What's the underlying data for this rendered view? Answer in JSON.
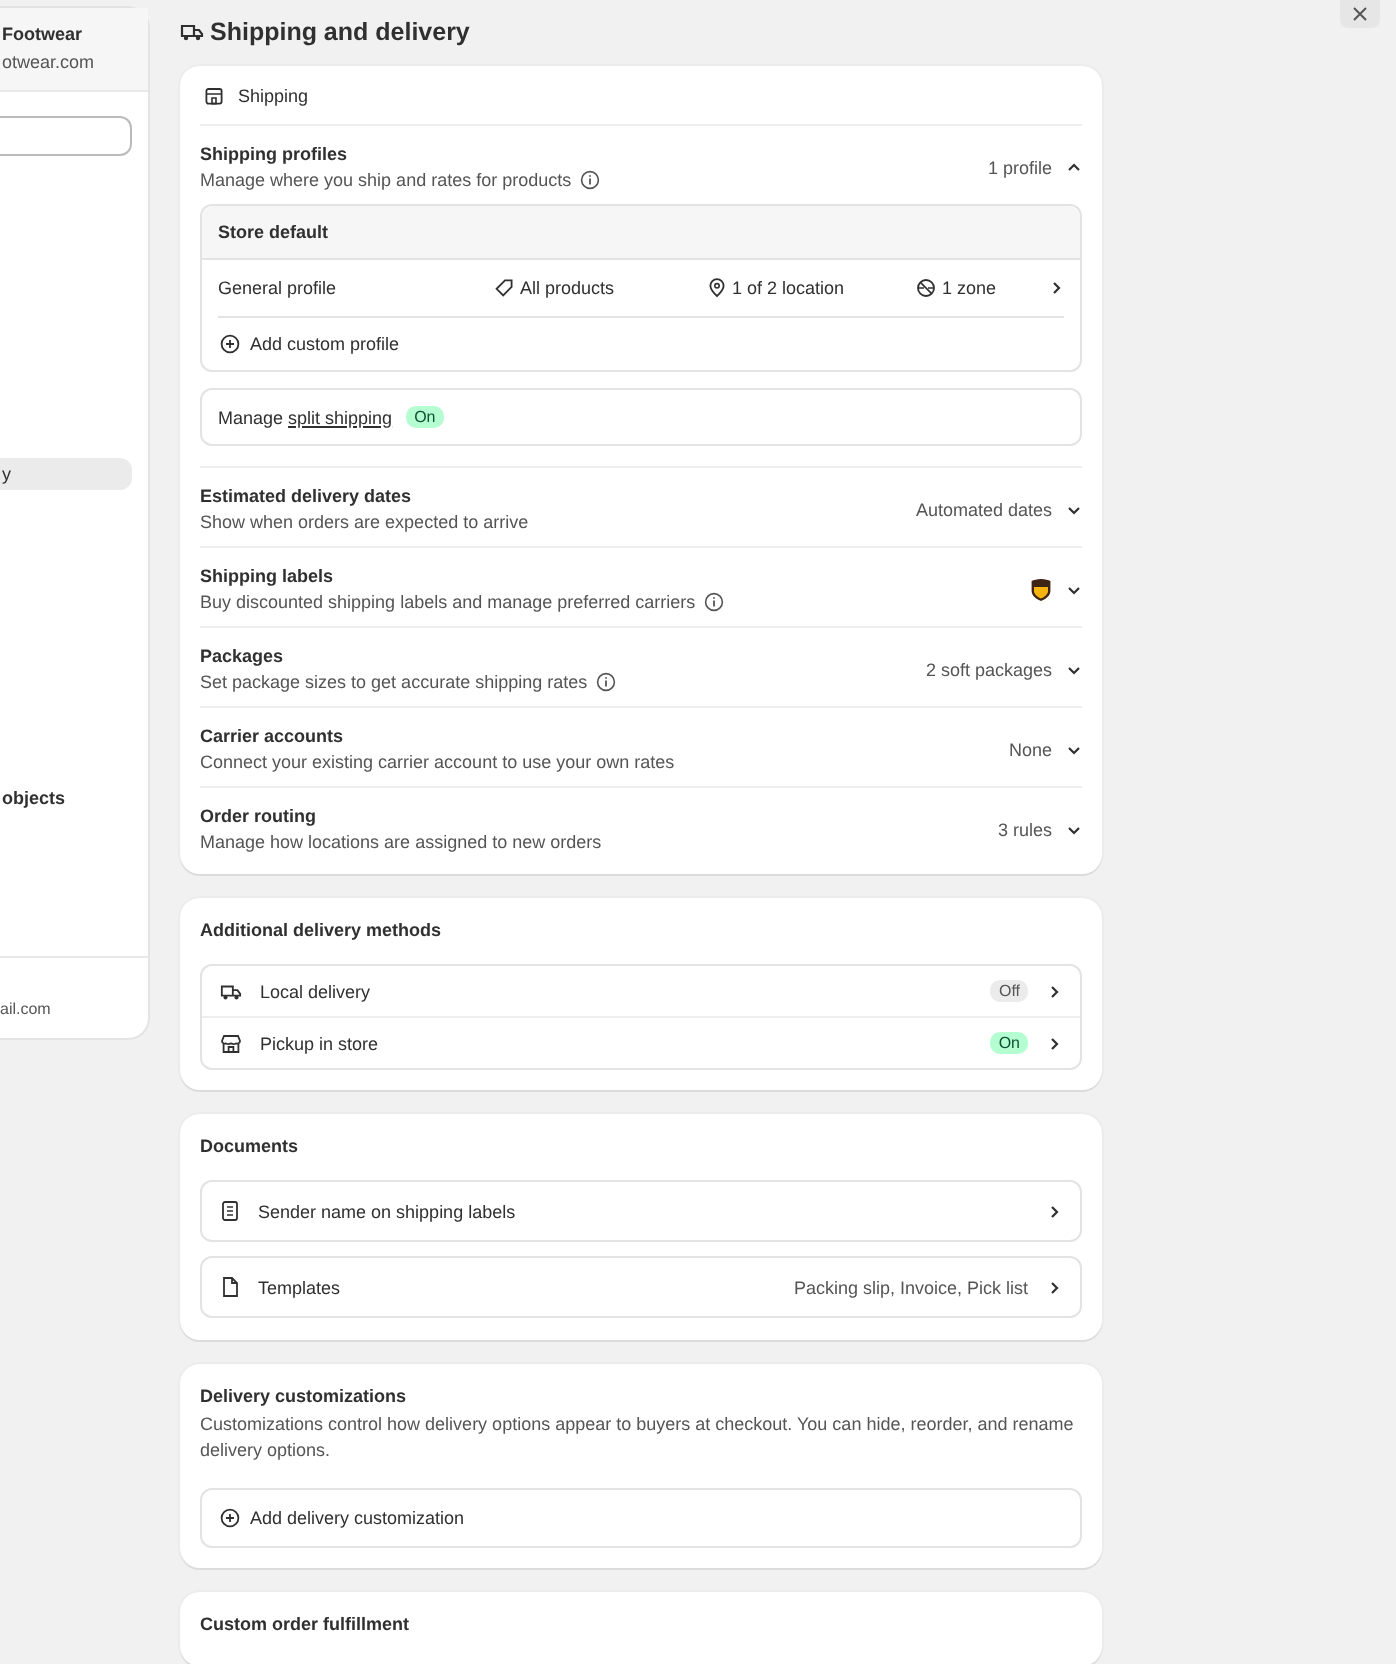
{
  "sidebar": {
    "store_name": "Footwear",
    "store_domain": "otwear.com",
    "items": [
      {
        "label": "y",
        "selected": true
      },
      {
        "label": "objects",
        "selected": false
      }
    ],
    "footer": "ail.com"
  },
  "page_title": "Shipping and delivery",
  "shipping": {
    "header": "Shipping",
    "profiles": {
      "title": "Shipping profiles",
      "description": "Manage where you ship and rates for products",
      "summary": "1 profile",
      "expanded": true,
      "group_title": "Store default",
      "profile": {
        "name": "General profile",
        "products": "All products",
        "locations": "1 of 2 location",
        "zones": "1 zone"
      },
      "add_label": "Add custom profile"
    },
    "split": {
      "prefix": "Manage",
      "link": "split shipping",
      "status": "On",
      "on": true
    },
    "settings": [
      {
        "title": "Estimated delivery dates",
        "description": "Show when orders are expected to arrive",
        "info": false,
        "kind": "text",
        "value": "Automated dates"
      },
      {
        "title": "Shipping labels",
        "description": "Buy discounted shipping labels and manage preferred carriers",
        "info": true,
        "kind": "carrier_logo"
      },
      {
        "title": "Packages",
        "description": "Set package sizes to get accurate shipping rates",
        "info": true,
        "kind": "text",
        "value": "2 soft packages"
      },
      {
        "title": "Carrier accounts",
        "description": "Connect your existing carrier account to use your own rates",
        "info": false,
        "kind": "text",
        "value": "None"
      },
      {
        "title": "Order routing",
        "description": "Manage how locations are assigned to new orders",
        "info": false,
        "kind": "text",
        "value": "3 rules"
      }
    ]
  },
  "additional_delivery": {
    "title": "Additional delivery methods",
    "methods": [
      {
        "kind": "local",
        "label": "Local delivery",
        "status": "Off",
        "on": false
      },
      {
        "kind": "pickup",
        "label": "Pickup in store",
        "status": "On",
        "on": true
      }
    ]
  },
  "documents": {
    "title": "Documents",
    "items": [
      {
        "kind": "sender",
        "label": "Sender name on shipping labels"
      },
      {
        "kind": "template",
        "label": "Templates",
        "value": "Packing slip, Invoice, Pick list"
      }
    ]
  },
  "delivery_customizations": {
    "title": "Delivery customizations",
    "description": "Customizations control how delivery options appear to buyers at checkout. You can hide, reorder, and rename delivery options.",
    "add_label": "Add delivery customization"
  },
  "custom_fulfillment": {
    "title": "Custom order fulfillment"
  }
}
